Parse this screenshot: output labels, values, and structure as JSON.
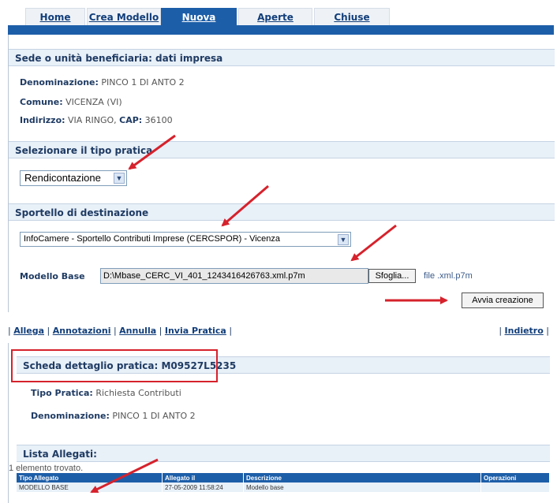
{
  "tabs": [
    {
      "label": "Home",
      "active": false
    },
    {
      "label": "Crea Modello",
      "active": false
    },
    {
      "label": "Nuova",
      "active": true
    },
    {
      "label": "Aperte",
      "active": false
    },
    {
      "label": "Chiuse",
      "active": false
    }
  ],
  "section_impresa": {
    "title": "Sede o unità beneficiaria: dati impresa",
    "denominazione_label": "Denominazione:",
    "denominazione_value": "PINCO 1 DI ANTO 2",
    "comune_label": "Comune:",
    "comune_value": "VICENZA  (VI)",
    "indirizzo_label": "Indirizzo:",
    "indirizzo_value": "VIA RINGO,",
    "cap_label": "CAP:",
    "cap_value": "36100"
  },
  "section_tipo": {
    "title": "Selezionare il tipo pratica",
    "selected": "Rendicontazione"
  },
  "section_sportello": {
    "title": "Sportello di destinazione",
    "selected": "InfoCamere - Sportello Contributi Imprese (CERCSPOR) - Vicenza",
    "modello_label": "Modello Base",
    "modello_value": "D:\\Mbase_CERC_VI_401_1243416426763.xml.p7m",
    "browse_label": "Sfoglia...",
    "file_hint": "file .xml.p7m",
    "create_label": "Avvia creazione"
  },
  "actions": {
    "allega": "Allega",
    "annotazioni": "Annotazioni",
    "annulla": "Annulla",
    "invia": "Invia Pratica",
    "indietro": "Indietro"
  },
  "detail": {
    "title": "Scheda dettaglio pratica: M09527L5235",
    "tipo_label": "Tipo Pratica:",
    "tipo_value": "Richiesta Contributi",
    "denominazione_label": "Denominazione:",
    "denominazione_value": "PINCO 1 DI ANTO 2"
  },
  "allegati": {
    "title": "Lista Allegati:",
    "count_text": "1 elemento trovato.",
    "columns": [
      "Tipo Allegato",
      "Allegato il",
      "Descrizione",
      "Operazioni"
    ],
    "rows": [
      [
        "MODELLO BASE",
        "27-05-2009 11:58:24",
        "Modello base",
        ""
      ]
    ]
  },
  "colors": {
    "tab_active": "#1d5ea8",
    "header_bg": "#e8f0f8",
    "annotation_red": "#d6222c"
  }
}
